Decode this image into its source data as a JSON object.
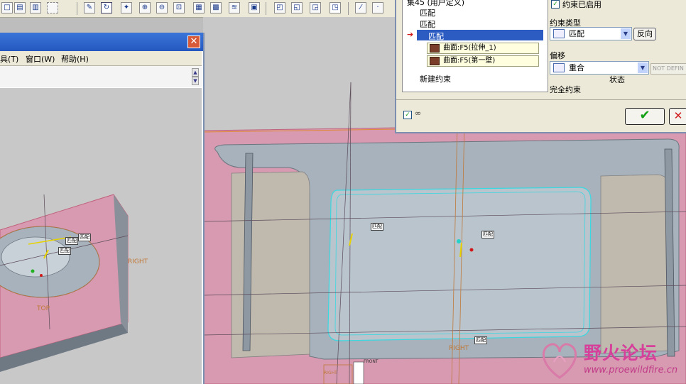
{
  "toolbar": {
    "icons": [
      "zoom-icon",
      "refit-icon",
      "datum-icon",
      "sketch-icon",
      "spin-icon",
      "zoom-in-icon",
      "zoom-out-icon",
      "view-icon",
      "orient-icon",
      "layer-icon",
      "shade-icon",
      "cube-icon"
    ]
  },
  "left_window": {
    "menu": [
      "具(T)",
      "窗口(W)",
      "帮助(H)"
    ],
    "datum_labels": {
      "right": "RIGHT",
      "top": "TOP"
    },
    "tags": [
      "匹配",
      "匹配",
      "匹配"
    ]
  },
  "dialog": {
    "tree": {
      "set_label": "集45 (用户定义)",
      "items": [
        "匹配",
        "匹配"
      ],
      "selected": "匹配",
      "refs": [
        "曲面:F5(拉伸_1)",
        "曲面:F5(第一壁)"
      ],
      "new_constraint": "新建约束"
    },
    "enabled_label": "约束已启用",
    "constraint_type_label": "约束类型",
    "constraint_type_value": "匹配",
    "flip_button": "反向",
    "offset_label": "偏移",
    "offset_value": "重合",
    "offset_field": "NOT DEFIN",
    "status_label": "状态",
    "status_value": "完全约束",
    "ok_icon": "check-icon",
    "cancel_icon": "close-icon"
  },
  "main_view": {
    "tags": [
      "匹配",
      "匹配",
      "匹配"
    ],
    "datum_labels": {
      "right": "RIGHT",
      "right_small": "RIGHT",
      "front": "FRONT"
    }
  },
  "watermark": {
    "title": "野火论坛",
    "url": "www.proewildfire.cn"
  },
  "colors": {
    "accent_blue": "#2c5cc2",
    "model_pink": "#d79ab0",
    "model_gray": "#a7b2bc",
    "edge_cyan": "#3ad8e0",
    "datum_orange": "#c07838"
  }
}
